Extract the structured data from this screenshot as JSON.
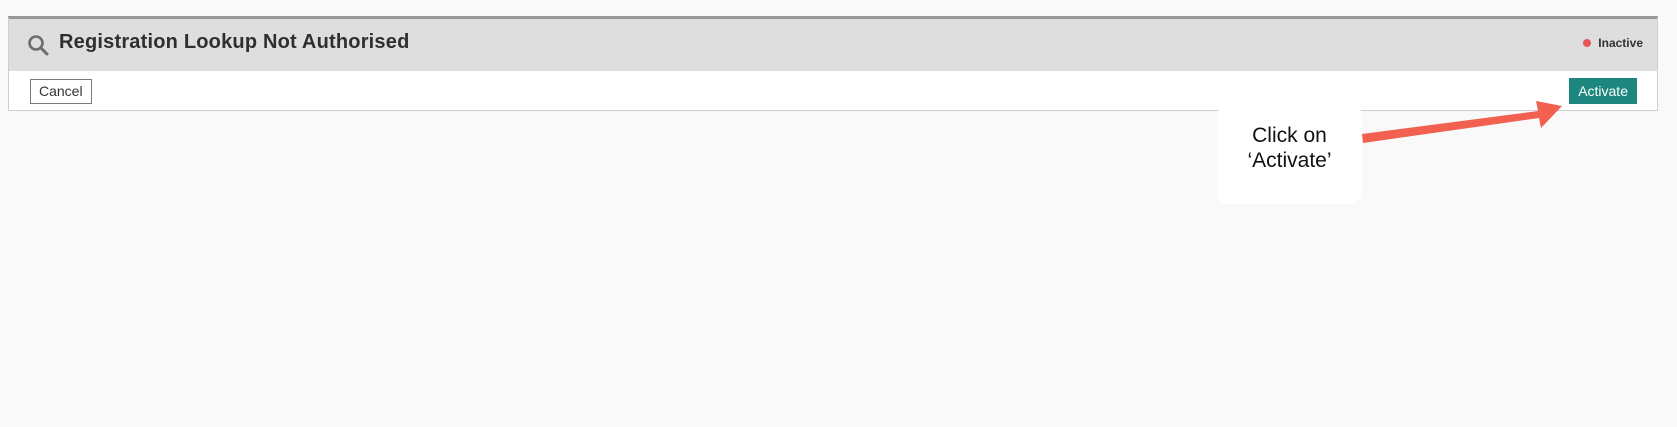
{
  "header": {
    "title": "Registration Lookup Not Authorised",
    "status_label": "Inactive",
    "status_color": "#e85454",
    "icon": "search-icon"
  },
  "actions": {
    "cancel_label": "Cancel",
    "activate_label": "Activate",
    "activate_color": "#1d877f"
  },
  "annotation": {
    "line1": "Click on",
    "line2": "‘Activate’",
    "arrow_color": "#f2604f"
  }
}
